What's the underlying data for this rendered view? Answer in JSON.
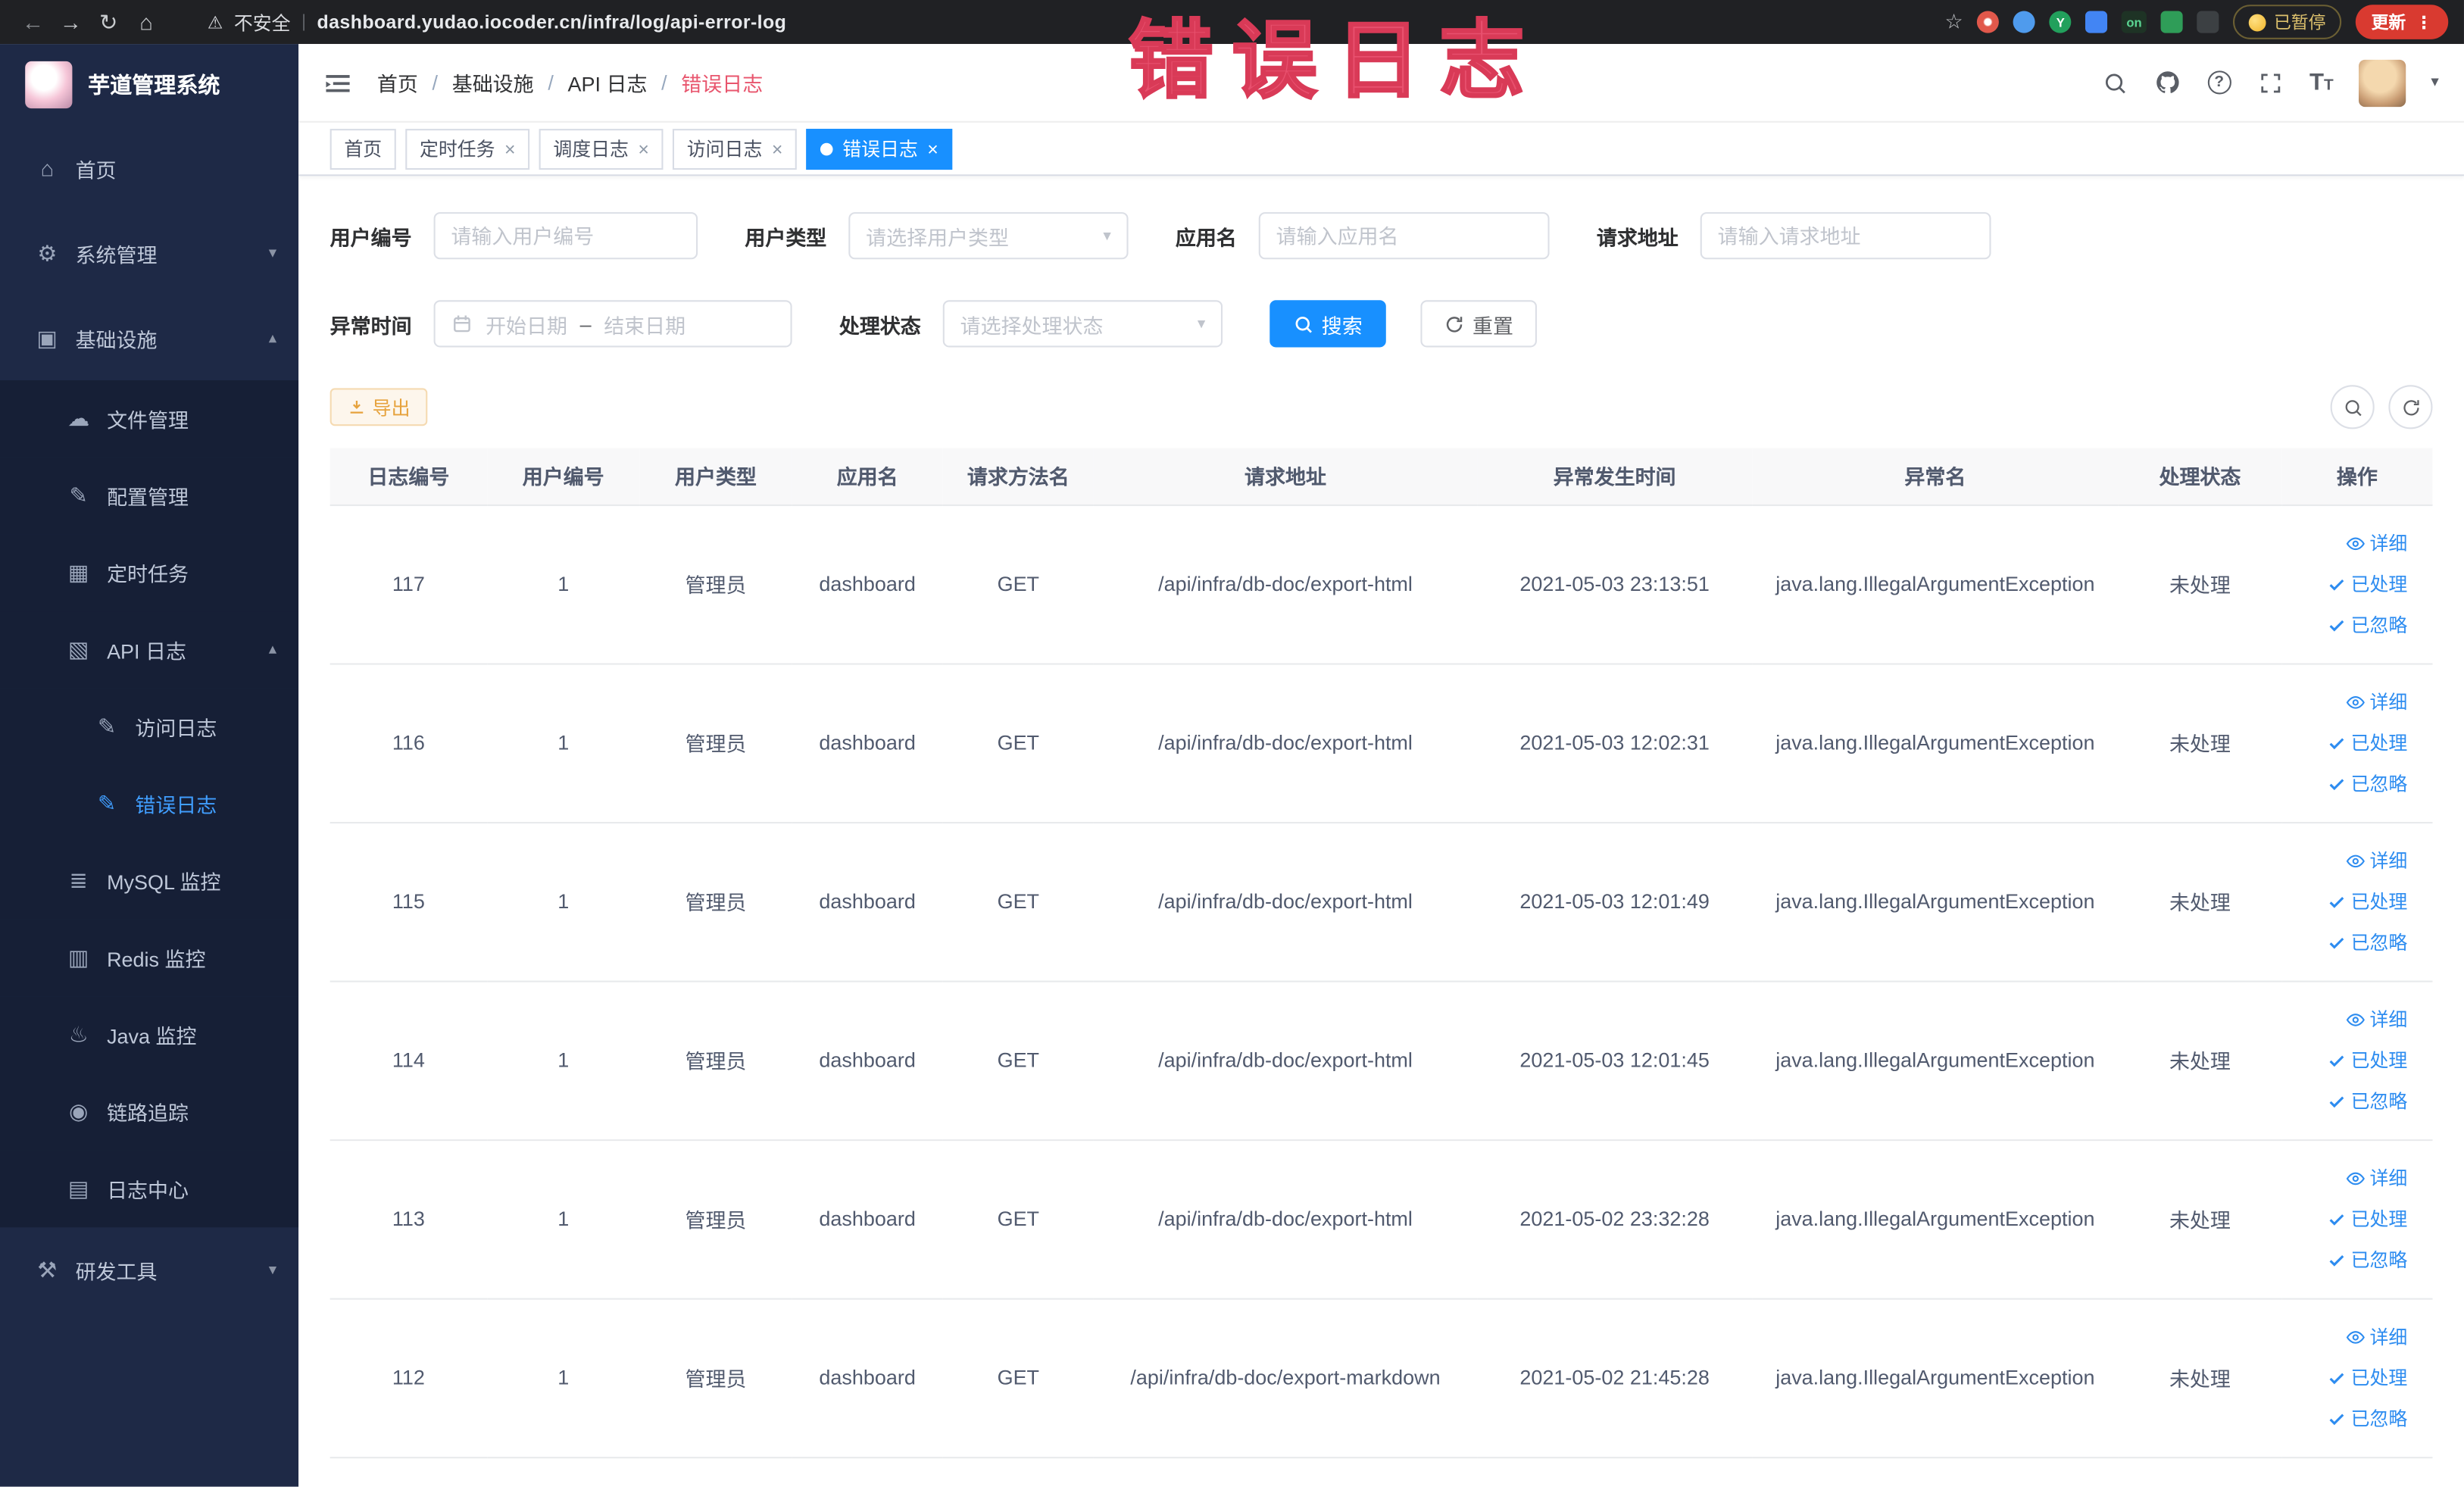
{
  "browser": {
    "security_label": "不安全",
    "url": "dashboard.yudao.iocoder.cn/infra/log/api-error-log",
    "paused_label": "已暂停",
    "update_label": "更新"
  },
  "overlay": {
    "text": "错误日志",
    "color": "#e8506e"
  },
  "app": {
    "title": "芋道管理系统"
  },
  "sidebar": {
    "items": [
      {
        "label": "首页",
        "icon": "home-icon",
        "level": 1
      },
      {
        "label": "系统管理",
        "icon": "gear-icon",
        "level": 1,
        "chevron": "down"
      },
      {
        "label": "基础设施",
        "icon": "monitor-icon",
        "level": 1,
        "chevron": "up"
      },
      {
        "label": "文件管理",
        "icon": "cloud-icon",
        "level": 2
      },
      {
        "label": "配置管理",
        "icon": "edit-icon",
        "level": 2
      },
      {
        "label": "定时任务",
        "icon": "schedule-icon",
        "level": 2
      },
      {
        "label": "API 日志",
        "icon": "api-log-icon",
        "level": 2,
        "chevron": "up"
      },
      {
        "label": "访问日志",
        "icon": "doc-edit-icon",
        "level": 3
      },
      {
        "label": "错误日志",
        "icon": "doc-edit-icon",
        "level": 3,
        "active": true
      },
      {
        "label": "MySQL 监控",
        "icon": "mysql-icon",
        "level": 2
      },
      {
        "label": "Redis 监控",
        "icon": "redis-icon",
        "level": 2
      },
      {
        "label": "Java 监控",
        "icon": "java-icon",
        "level": 2
      },
      {
        "label": "链路追踪",
        "icon": "trace-icon",
        "level": 2
      },
      {
        "label": "日志中心",
        "icon": "log-center-icon",
        "level": 2
      },
      {
        "label": "研发工具",
        "icon": "tools-icon",
        "level": 1,
        "chevron": "down"
      }
    ]
  },
  "header": {
    "breadcrumb": [
      {
        "label": "首页"
      },
      {
        "label": "基础设施"
      },
      {
        "label": "API 日志"
      },
      {
        "label": "错误日志",
        "current": true
      }
    ]
  },
  "tabs": [
    {
      "label": "首页",
      "closable": false,
      "active": false
    },
    {
      "label": "定时任务",
      "closable": true,
      "active": false
    },
    {
      "label": "调度日志",
      "closable": true,
      "active": false
    },
    {
      "label": "访问日志",
      "closable": true,
      "active": false
    },
    {
      "label": "错误日志",
      "closable": true,
      "active": true
    }
  ],
  "filter": {
    "user_id": {
      "label": "用户编号",
      "placeholder": "请输入用户编号"
    },
    "user_type": {
      "label": "用户类型",
      "placeholder": "请选择用户类型"
    },
    "app_name": {
      "label": "应用名",
      "placeholder": "请输入应用名"
    },
    "request_url": {
      "label": "请求地址",
      "placeholder": "请输入请求地址"
    },
    "exception_time": {
      "label": "异常时间",
      "start_placeholder": "开始日期",
      "separator": "–",
      "end_placeholder": "结束日期"
    },
    "process_status": {
      "label": "处理状态",
      "placeholder": "请选择处理状态"
    },
    "search_label": "搜索",
    "reset_label": "重置"
  },
  "toolbar": {
    "export_label": "导出"
  },
  "table": {
    "columns": [
      "日志编号",
      "用户编号",
      "用户类型",
      "应用名",
      "请求方法名",
      "请求地址",
      "异常发生时间",
      "异常名",
      "处理状态",
      "操作"
    ],
    "actions": [
      {
        "label": "详细",
        "icon": "eye-icon"
      },
      {
        "label": "已处理",
        "icon": "check-icon"
      },
      {
        "label": "已忽略",
        "icon": "check-icon"
      }
    ],
    "rows": [
      {
        "log_id": "117",
        "user_id": "1",
        "user_type": "管理员",
        "app": "dashboard",
        "method": "GET",
        "url": "/api/infra/db-doc/export-html",
        "time": "2021-05-03 23:13:51",
        "exception": "java.lang.IllegalArgumentException",
        "status": "未处理"
      },
      {
        "log_id": "116",
        "user_id": "1",
        "user_type": "管理员",
        "app": "dashboard",
        "method": "GET",
        "url": "/api/infra/db-doc/export-html",
        "time": "2021-05-03 12:02:31",
        "exception": "java.lang.IllegalArgumentException",
        "status": "未处理"
      },
      {
        "log_id": "115",
        "user_id": "1",
        "user_type": "管理员",
        "app": "dashboard",
        "method": "GET",
        "url": "/api/infra/db-doc/export-html",
        "time": "2021-05-03 12:01:49",
        "exception": "java.lang.IllegalArgumentException",
        "status": "未处理"
      },
      {
        "log_id": "114",
        "user_id": "1",
        "user_type": "管理员",
        "app": "dashboard",
        "method": "GET",
        "url": "/api/infra/db-doc/export-html",
        "time": "2021-05-03 12:01:45",
        "exception": "java.lang.IllegalArgumentException",
        "status": "未处理"
      },
      {
        "log_id": "113",
        "user_id": "1",
        "user_type": "管理员",
        "app": "dashboard",
        "method": "GET",
        "url": "/api/infra/db-doc/export-html",
        "time": "2021-05-02 23:32:28",
        "exception": "java.lang.IllegalArgumentException",
        "status": "未处理"
      },
      {
        "log_id": "112",
        "user_id": "1",
        "user_type": "管理员",
        "app": "dashboard",
        "method": "GET",
        "url": "/api/infra/db-doc/export-markdown",
        "time": "2021-05-02 21:45:28",
        "exception": "java.lang.IllegalArgumentException",
        "status": "未处理"
      }
    ]
  }
}
